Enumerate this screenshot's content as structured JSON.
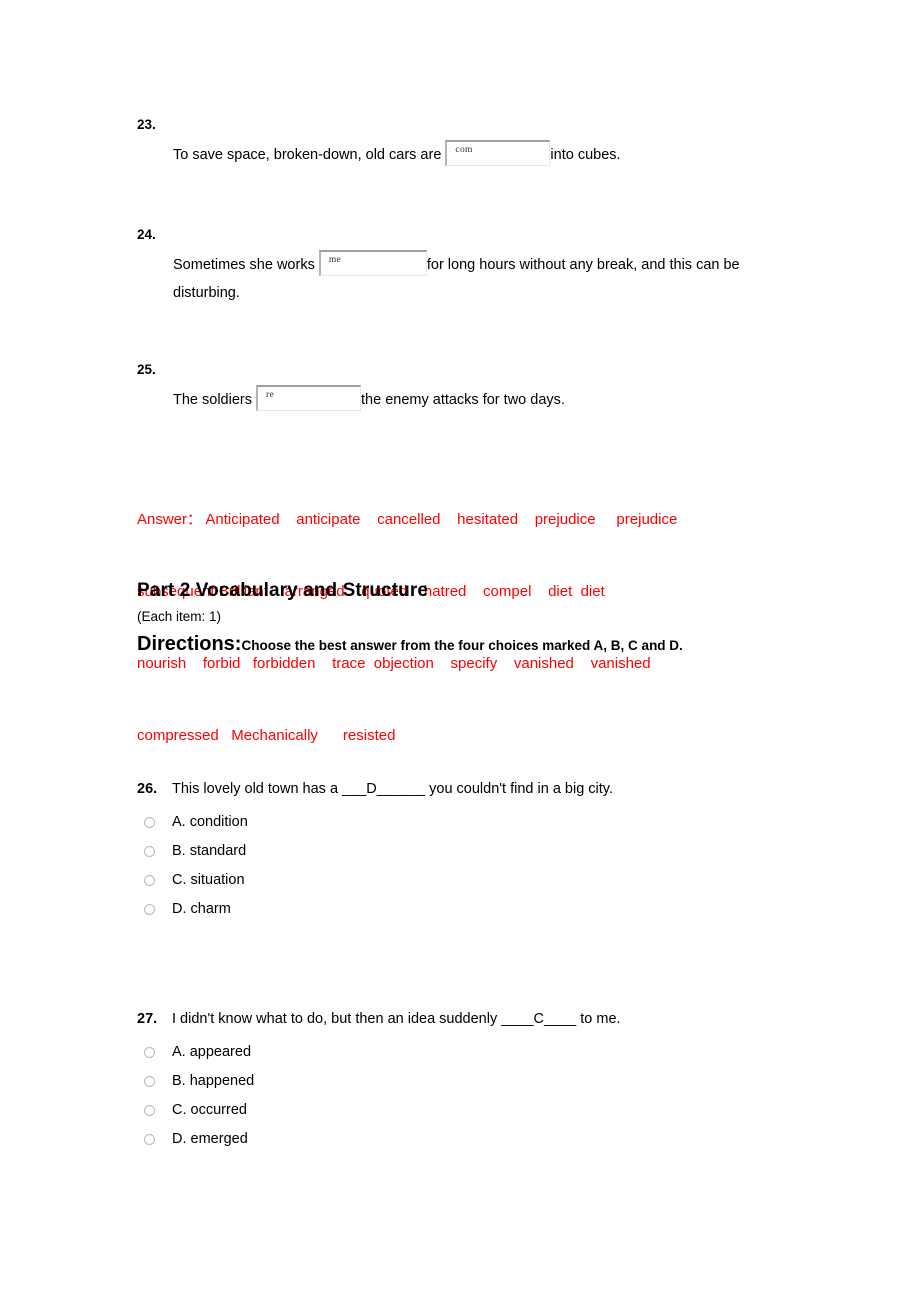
{
  "document": {
    "fill_questions": [
      {
        "number": "23.",
        "text_before": "To save space, broken-down, old cars are ",
        "input_value": "com",
        "input_width": 105,
        "text_after": "into cubes."
      },
      {
        "number": "24.",
        "text_before": "Sometimes she works ",
        "input_value": "me",
        "input_width": 108,
        "text_after": "for long hours without any break, and this can be",
        "text_line2": "disturbing."
      },
      {
        "number": "25.",
        "text_before": "The soldiers ",
        "input_value": "re",
        "input_width": 105,
        "text_after": "the enemy attacks for two days."
      }
    ],
    "answer_key": {
      "label": "Answer：",
      "line1": "Answer： Anticipated    anticipate    cancelled    hesitated    prejudice     prejudice",
      "line2": "subsequent Brilliant    arranged    quoted    hatred    compel    diet  diet",
      "line3": "nourish    forbid   forbidden    trace  objection    specify    vanished    vanished",
      "line4": "compressed   Mechanically      resisted",
      "color": "#ff0000",
      "words": [
        "Anticipated",
        "anticipate",
        "cancelled",
        "hesitated",
        "prejudice",
        "prejudice",
        "subsequent",
        "Brilliant",
        "arranged",
        "quoted",
        "hatred",
        "compel",
        "diet",
        "diet",
        "nourish",
        "forbid",
        "forbidden",
        "trace",
        "objection",
        "specify",
        "vanished",
        "vanished",
        "compressed",
        "Mechanically",
        "resisted"
      ]
    },
    "part_heading": {
      "title": "Part 2 Vocabulary and Structure",
      "each_item": "(Each item: 1)",
      "directions_label": "Directions:",
      "directions_text": "Choose the best answer from the four choices marked A, B, C and D."
    },
    "mc_questions": [
      {
        "number": "26.",
        "stem": "This lovely old town has a ___D______ you couldn't find in a big city.",
        "options": [
          {
            "label": "A. condition"
          },
          {
            "label": "B. standard"
          },
          {
            "label": "C. situation"
          },
          {
            "label": "D. charm"
          }
        ]
      },
      {
        "number": "27.",
        "stem": "I didn't know what to do, but then an idea suddenly ____C____ to me.",
        "options": [
          {
            "label": "A. appeared"
          },
          {
            "label": "B. happened"
          },
          {
            "label": "C. occurred"
          },
          {
            "label": "D. emerged"
          }
        ]
      }
    ]
  }
}
